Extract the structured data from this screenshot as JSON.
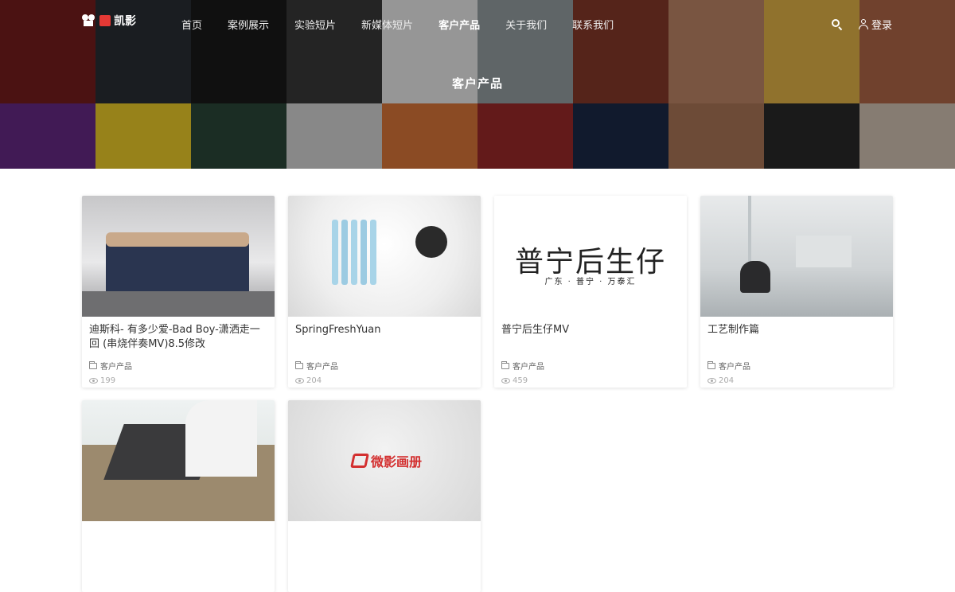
{
  "brand": {
    "logo_text": "凯影",
    "accent": "#e53935"
  },
  "nav": {
    "items": [
      {
        "label": "首页"
      },
      {
        "label": "案例展示"
      },
      {
        "label": "实验短片"
      },
      {
        "label": "新媒体短片"
      },
      {
        "label": "客户产品",
        "active": true
      },
      {
        "label": "关于我们"
      },
      {
        "label": "联系我们"
      }
    ],
    "search_icon": "search-icon",
    "login_label": "登录"
  },
  "hero": {
    "title": "客户产品"
  },
  "cards": [
    {
      "title": "迪斯科- 有多少爱-Bad Boy-潇洒走一回 (串烧伴奏MV)8.5修改",
      "category": "客户产品",
      "views": "199"
    },
    {
      "title": "SpringFreshYuan",
      "category": "客户产品",
      "views": "204"
    },
    {
      "title": "普宁后生仔MV",
      "category": "客户产品",
      "views": "459",
      "thumb_text": "普宁后生仔",
      "thumb_sub": "广东 · 普宁 · 万泰汇"
    },
    {
      "title": "工艺制作篇",
      "category": "客户产品",
      "views": "204"
    },
    {
      "title": "",
      "category": "",
      "views": ""
    },
    {
      "title": "",
      "category": "",
      "views": "",
      "thumb_text": "微影画册"
    }
  ]
}
